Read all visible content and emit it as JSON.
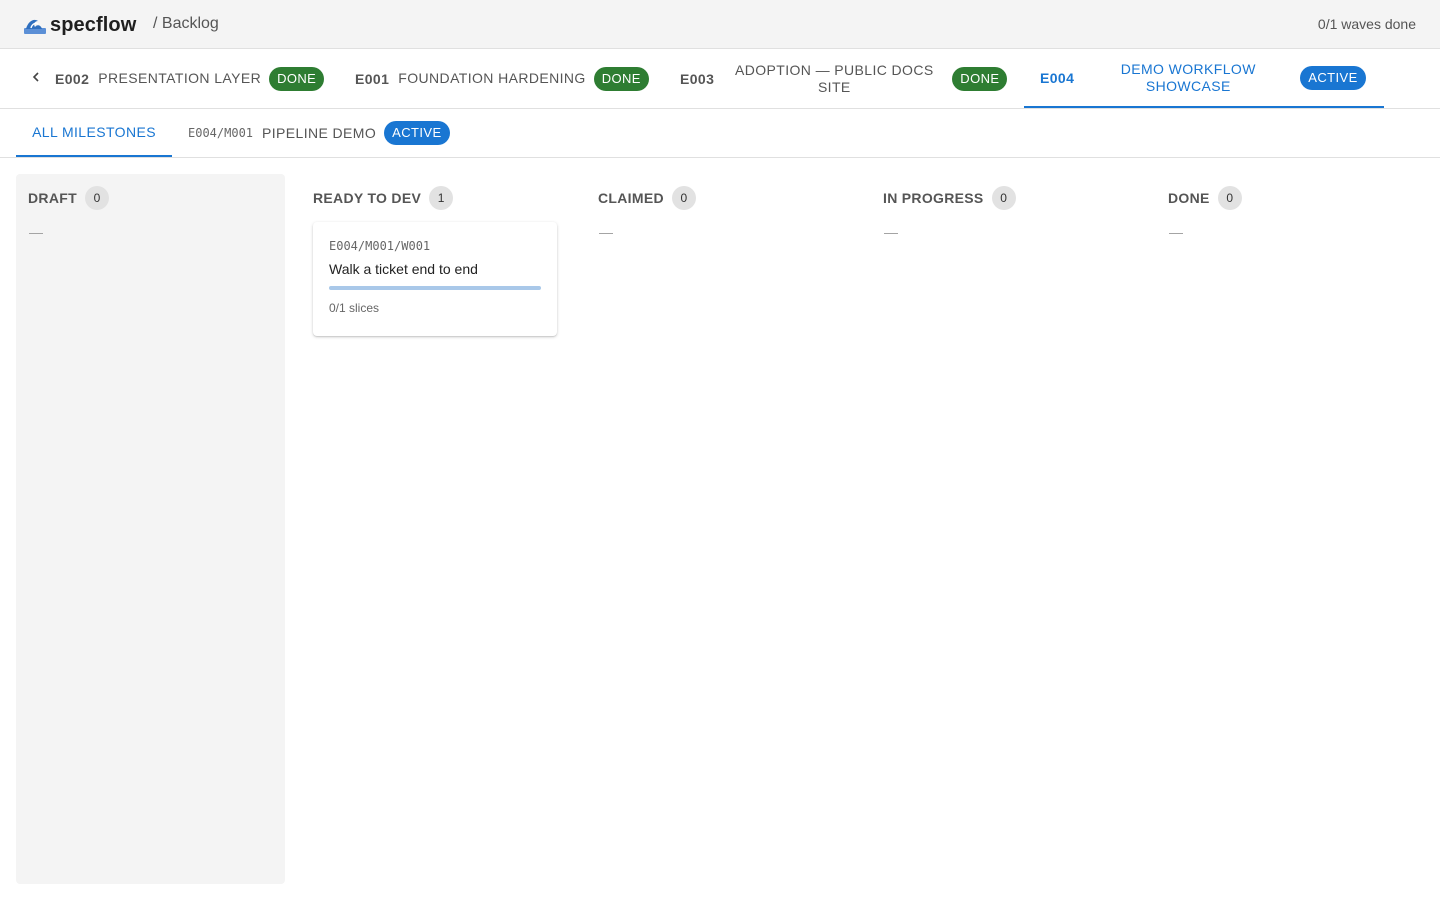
{
  "header": {
    "brand": "specflow",
    "breadcrumb": "/ Backlog",
    "waves_status": "0/1 waves done"
  },
  "epics": [
    {
      "code": "E002",
      "title": "PRESENTATION LAYER",
      "status": "DONE"
    },
    {
      "code": "E001",
      "title": "FOUNDATION HARDENING",
      "status": "DONE"
    },
    {
      "code": "E003",
      "title": "ADOPTION — PUBLIC DOCS SITE",
      "status": "DONE"
    },
    {
      "code": "E004",
      "title": "DEMO WORKFLOW SHOWCASE",
      "status": "ACTIVE",
      "selected": true
    }
  ],
  "milestones": {
    "all_label": "ALL MILESTONES",
    "items": [
      {
        "code": "E004/M001",
        "title": "PIPELINE DEMO",
        "status": "ACTIVE"
      }
    ]
  },
  "columns": [
    {
      "title": "DRAFT",
      "count": "0",
      "empty": "—"
    },
    {
      "title": "READY TO DEV",
      "count": "1",
      "cards": [
        {
          "code": "E004/M001/W001",
          "title": "Walk a ticket end to end",
          "meta": "0/1 slices",
          "progress": 0
        }
      ]
    },
    {
      "title": "CLAIMED",
      "count": "0",
      "empty": "—"
    },
    {
      "title": "IN PROGRESS",
      "count": "0",
      "empty": "—"
    },
    {
      "title": "DONE",
      "count": "0",
      "empty": "—"
    }
  ],
  "colors": {
    "accent": "#1976d2",
    "done": "#2e7d32"
  }
}
